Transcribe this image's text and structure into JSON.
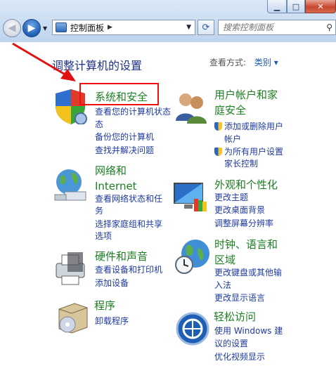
{
  "toolbar": {
    "address": "控制面板",
    "search_placeholder": "搜索控制面板"
  },
  "main": {
    "heading": "调整计算机的设置",
    "view_by_label": "查看方式:",
    "view_by_value": "类别"
  },
  "categories": {
    "system_security": {
      "title": "系统和安全",
      "links": [
        "查看您的计算机状态",
        "备份您的计算机",
        "查找并解决问题"
      ]
    },
    "user_accounts": {
      "title_1": "用户帐户和家",
      "title_2": "庭安全",
      "links": [
        "添加或删除用户",
        "帐户",
        "为所有用户设置",
        "家长控制"
      ]
    },
    "network": {
      "title_1": "网络和",
      "title_2": "Internet",
      "links": [
        "查看网络状态和任",
        "务",
        "选择家庭组和共享",
        "选项"
      ]
    },
    "appearance": {
      "title": "外观和个性化",
      "links": [
        "更改主题",
        "更改桌面背景",
        "调整屏幕分辨率"
      ]
    },
    "hardware": {
      "title": "硬件和声音",
      "links": [
        "查看设备和打印机",
        "添加设备"
      ]
    },
    "clock": {
      "title_1": "时钟、语言和",
      "title_2": "区域",
      "links": [
        "更改键盘或其他输",
        "入法",
        "更改显示语言"
      ]
    },
    "programs": {
      "title": "程序",
      "links": [
        "卸载程序"
      ]
    },
    "ease": {
      "title": "轻松访问",
      "links": [
        "使用 Windows 建",
        "议的设置",
        "优化视频显示"
      ]
    }
  },
  "colors": {
    "category_title": "#1c7f22",
    "link": "#1e3aa0",
    "annotation": "#e11111"
  }
}
